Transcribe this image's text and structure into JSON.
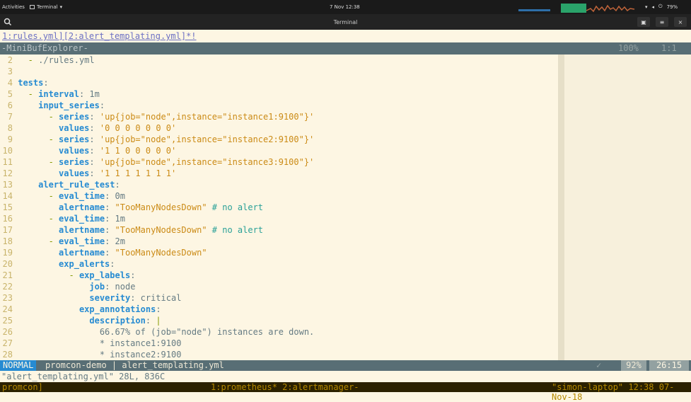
{
  "topbar": {
    "activities": "Activities",
    "app_menu": "Terminal",
    "clock": "7 Nov  12:38",
    "battery": "79%",
    "icons": [
      "wifi-icon",
      "volume-icon",
      "power-icon",
      "battery-icon"
    ]
  },
  "terminal": {
    "title": "Terminal",
    "buttons": [
      "new-tab-icon",
      "menu-icon",
      "close-icon"
    ]
  },
  "vim": {
    "tabline": "1:rules.yml][2:alert_templating.yml]*!",
    "minibuf": {
      "name": "-MiniBufExplorer-",
      "percent": "100%",
      "position": "1:1"
    },
    "lines": [
      {
        "n": "2",
        "parts": [
          {
            "c": "c-dash",
            "t": "  - "
          },
          {
            "c": "c-txt",
            "t": "./rules.yml"
          }
        ]
      },
      {
        "n": "3",
        "parts": []
      },
      {
        "n": "4",
        "parts": [
          {
            "c": "c-key",
            "t": "tests"
          },
          {
            "c": "c-txt",
            "t": ":"
          }
        ]
      },
      {
        "n": "5",
        "parts": [
          {
            "c": "c-dash",
            "t": "  - "
          },
          {
            "c": "c-key",
            "t": "interval"
          },
          {
            "c": "c-txt",
            "t": ": 1m"
          }
        ]
      },
      {
        "n": "6",
        "parts": [
          {
            "c": "c-txt",
            "t": "    "
          },
          {
            "c": "c-key",
            "t": "input_series"
          },
          {
            "c": "c-txt",
            "t": ":"
          }
        ]
      },
      {
        "n": "7",
        "parts": [
          {
            "c": "c-dash",
            "t": "      - "
          },
          {
            "c": "c-key",
            "t": "series"
          },
          {
            "c": "c-txt",
            "t": ": "
          },
          {
            "c": "c-str",
            "t": "'up{job=\"node\",instance=\"instance1:9100\"}'"
          }
        ]
      },
      {
        "n": "8",
        "parts": [
          {
            "c": "c-txt",
            "t": "        "
          },
          {
            "c": "c-key",
            "t": "values"
          },
          {
            "c": "c-txt",
            "t": ": "
          },
          {
            "c": "c-str",
            "t": "'0 0 0 0 0 0 0'"
          }
        ]
      },
      {
        "n": "9",
        "parts": [
          {
            "c": "c-dash",
            "t": "      - "
          },
          {
            "c": "c-key",
            "t": "series"
          },
          {
            "c": "c-txt",
            "t": ": "
          },
          {
            "c": "c-str",
            "t": "'up{job=\"node\",instance=\"instance2:9100\"}'"
          }
        ]
      },
      {
        "n": "10",
        "parts": [
          {
            "c": "c-txt",
            "t": "        "
          },
          {
            "c": "c-key",
            "t": "values"
          },
          {
            "c": "c-txt",
            "t": ": "
          },
          {
            "c": "c-str",
            "t": "'1 1 0 0 0 0 0'"
          }
        ]
      },
      {
        "n": "11",
        "parts": [
          {
            "c": "c-dash",
            "t": "      - "
          },
          {
            "c": "c-key",
            "t": "series"
          },
          {
            "c": "c-txt",
            "t": ": "
          },
          {
            "c": "c-str",
            "t": "'up{job=\"node\",instance=\"instance3:9100\"}'"
          }
        ]
      },
      {
        "n": "12",
        "parts": [
          {
            "c": "c-txt",
            "t": "        "
          },
          {
            "c": "c-key",
            "t": "values"
          },
          {
            "c": "c-txt",
            "t": ": "
          },
          {
            "c": "c-str",
            "t": "'1 1 1 1 1 1 1'"
          }
        ]
      },
      {
        "n": "13",
        "parts": [
          {
            "c": "c-txt",
            "t": "    "
          },
          {
            "c": "c-key",
            "t": "alert_rule_test"
          },
          {
            "c": "c-txt",
            "t": ":"
          }
        ]
      },
      {
        "n": "14",
        "parts": [
          {
            "c": "c-dash",
            "t": "      - "
          },
          {
            "c": "c-key",
            "t": "eval_time"
          },
          {
            "c": "c-txt",
            "t": ": 0m"
          }
        ]
      },
      {
        "n": "15",
        "parts": [
          {
            "c": "c-txt",
            "t": "        "
          },
          {
            "c": "c-key",
            "t": "alertname"
          },
          {
            "c": "c-txt",
            "t": ": "
          },
          {
            "c": "c-str",
            "t": "\"TooManyNodesDown\""
          },
          {
            "c": "c-com",
            "t": " # no alert"
          }
        ]
      },
      {
        "n": "16",
        "parts": [
          {
            "c": "c-dash",
            "t": "      - "
          },
          {
            "c": "c-key",
            "t": "eval_time"
          },
          {
            "c": "c-txt",
            "t": ": 1m"
          }
        ]
      },
      {
        "n": "17",
        "parts": [
          {
            "c": "c-txt",
            "t": "        "
          },
          {
            "c": "c-key",
            "t": "alertname"
          },
          {
            "c": "c-txt",
            "t": ": "
          },
          {
            "c": "c-str",
            "t": "\"TooManyNodesDown\""
          },
          {
            "c": "c-com",
            "t": " # no alert"
          }
        ]
      },
      {
        "n": "18",
        "parts": [
          {
            "c": "c-dash",
            "t": "      - "
          },
          {
            "c": "c-key",
            "t": "eval_time"
          },
          {
            "c": "c-txt",
            "t": ": 2m"
          }
        ]
      },
      {
        "n": "19",
        "parts": [
          {
            "c": "c-txt",
            "t": "        "
          },
          {
            "c": "c-key",
            "t": "alertname"
          },
          {
            "c": "c-txt",
            "t": ": "
          },
          {
            "c": "c-str",
            "t": "\"TooManyNodesDown\""
          }
        ]
      },
      {
        "n": "20",
        "parts": [
          {
            "c": "c-txt",
            "t": "        "
          },
          {
            "c": "c-key",
            "t": "exp_alerts"
          },
          {
            "c": "c-txt",
            "t": ":"
          }
        ]
      },
      {
        "n": "21",
        "parts": [
          {
            "c": "c-dash",
            "t": "          - "
          },
          {
            "c": "c-key",
            "t": "exp_labels"
          },
          {
            "c": "c-txt",
            "t": ":"
          }
        ]
      },
      {
        "n": "22",
        "parts": [
          {
            "c": "c-txt",
            "t": "              "
          },
          {
            "c": "c-key",
            "t": "job"
          },
          {
            "c": "c-txt",
            "t": ": node"
          }
        ]
      },
      {
        "n": "23",
        "parts": [
          {
            "c": "c-txt",
            "t": "              "
          },
          {
            "c": "c-key",
            "t": "severity"
          },
          {
            "c": "c-txt",
            "t": ": critical"
          }
        ]
      },
      {
        "n": "24",
        "parts": [
          {
            "c": "c-txt",
            "t": "            "
          },
          {
            "c": "c-key",
            "t": "exp_annotations"
          },
          {
            "c": "c-txt",
            "t": ":"
          }
        ]
      },
      {
        "n": "25",
        "parts": [
          {
            "c": "c-txt",
            "t": "              "
          },
          {
            "c": "c-key",
            "t": "description"
          },
          {
            "c": "c-txt",
            "t": ": "
          },
          {
            "c": "c-pipe",
            "t": "|"
          }
        ]
      },
      {
        "n": "26",
        "parts": [
          {
            "c": "c-txt",
            "t": "                66.67% of (job=\"node\") instances are down."
          }
        ]
      },
      {
        "n": "27",
        "parts": [
          {
            "c": "c-txt",
            "t": "                * instance1:9100"
          }
        ]
      },
      {
        "n": "28",
        "parts": [
          {
            "c": "c-txt",
            "t": "                * instance2:9100"
          }
        ]
      }
    ],
    "status": {
      "mode": "NORMAL",
      "file": "promcon-demo | alert_templating.yml",
      "ok": "✓",
      "percent": "92%",
      "position": "26:15"
    },
    "cmdline": "\"alert_templating.yml\" 28L, 836C"
  },
  "tmux": {
    "session": "promcon]",
    "windows": "1:prometheus* 2:alertmanager-",
    "right": "\"simon-laptop\" 12:38 07-Nov-18"
  }
}
